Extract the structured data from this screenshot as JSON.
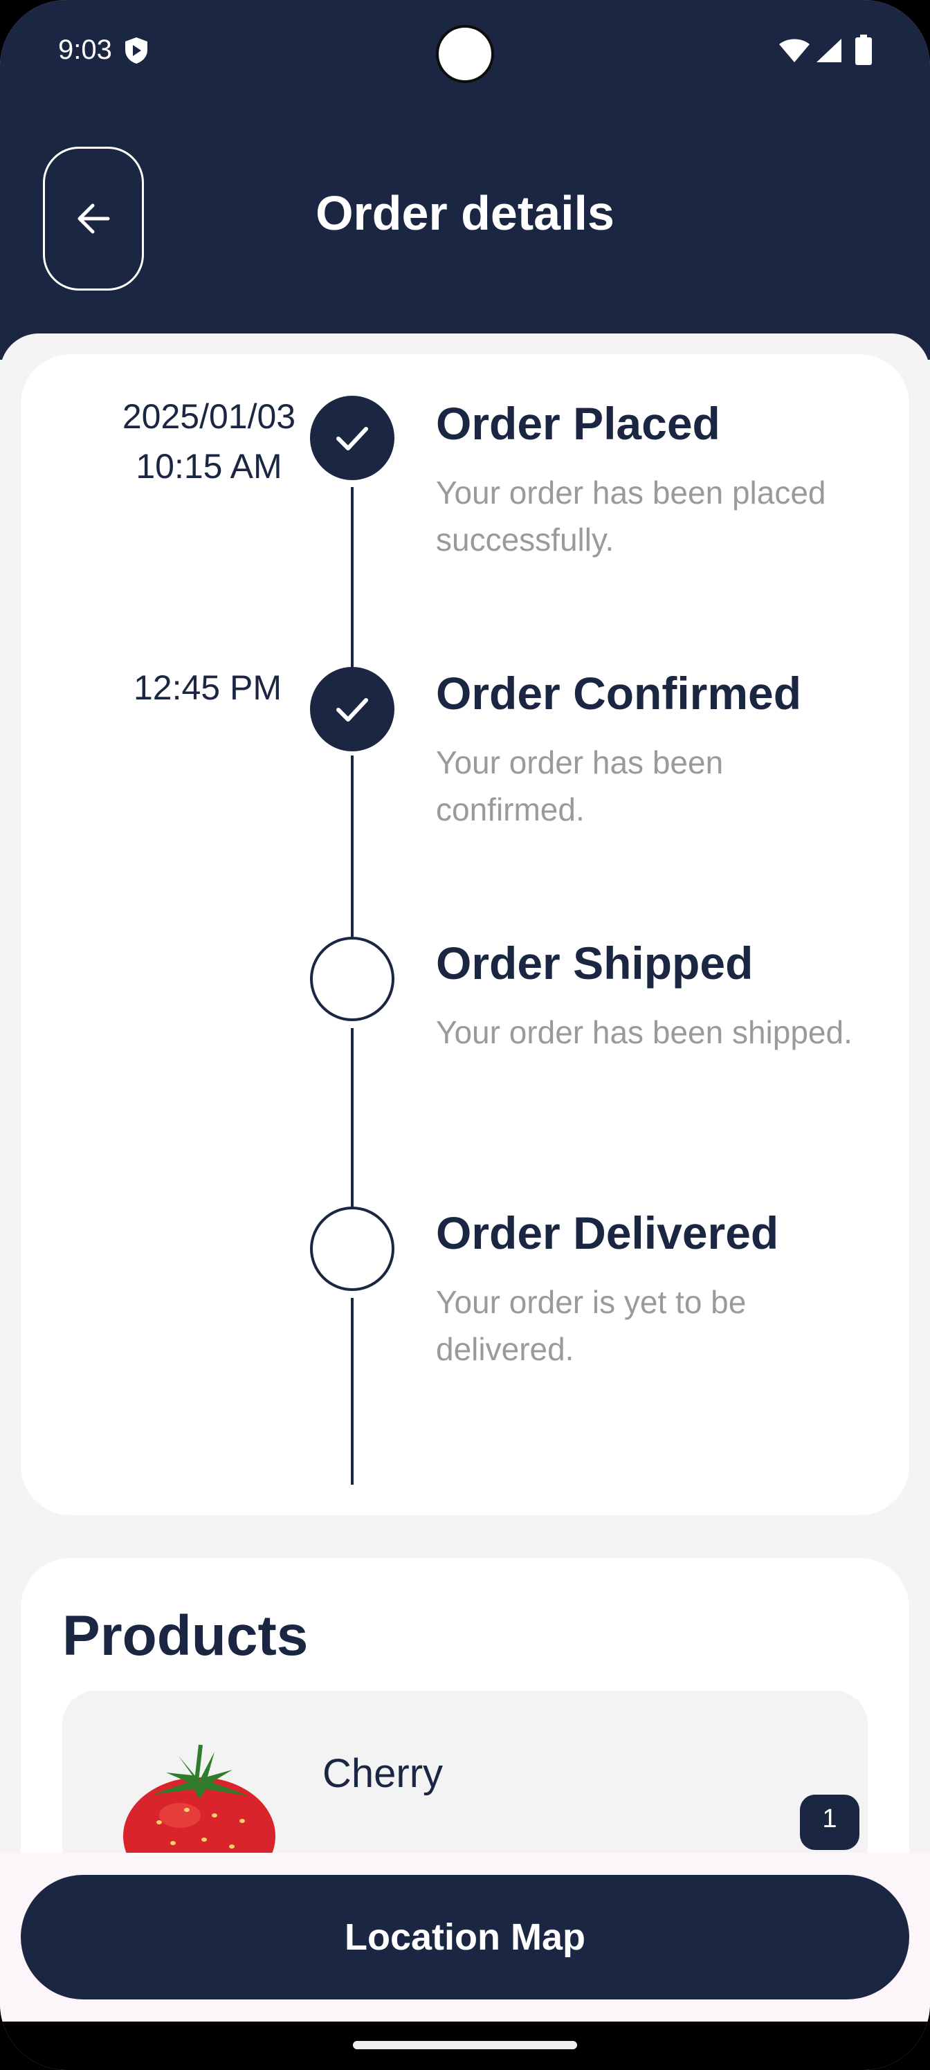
{
  "status_bar": {
    "time": "9:03"
  },
  "header": {
    "title": "Order details",
    "back_icon": "arrow-left-icon"
  },
  "timeline": [
    {
      "time_lines": [
        "2025/01/03",
        "10:15 AM"
      ],
      "title": "Order Placed",
      "description": "Your order has been placed successfully.",
      "status": "done"
    },
    {
      "time_lines": [
        "12:45 PM"
      ],
      "title": "Order Confirmed",
      "description": "Your order has been confirmed.",
      "status": "done"
    },
    {
      "time_lines": [],
      "title": "Order Shipped",
      "description": "Your order has been shipped.",
      "status": "pending"
    },
    {
      "time_lines": [],
      "title": "Order Delivered",
      "description": "Your order is yet to be delivered.",
      "status": "pending"
    }
  ],
  "products": {
    "title": "Products",
    "items": [
      {
        "name": "Cherry",
        "quantity": "1",
        "image": "strawberry-image"
      }
    ]
  },
  "bottom": {
    "button_label": "Location Map"
  },
  "colors": {
    "primary": "#1b2742",
    "muted": "#9a9a9a",
    "surface": "#f4f4f4"
  }
}
